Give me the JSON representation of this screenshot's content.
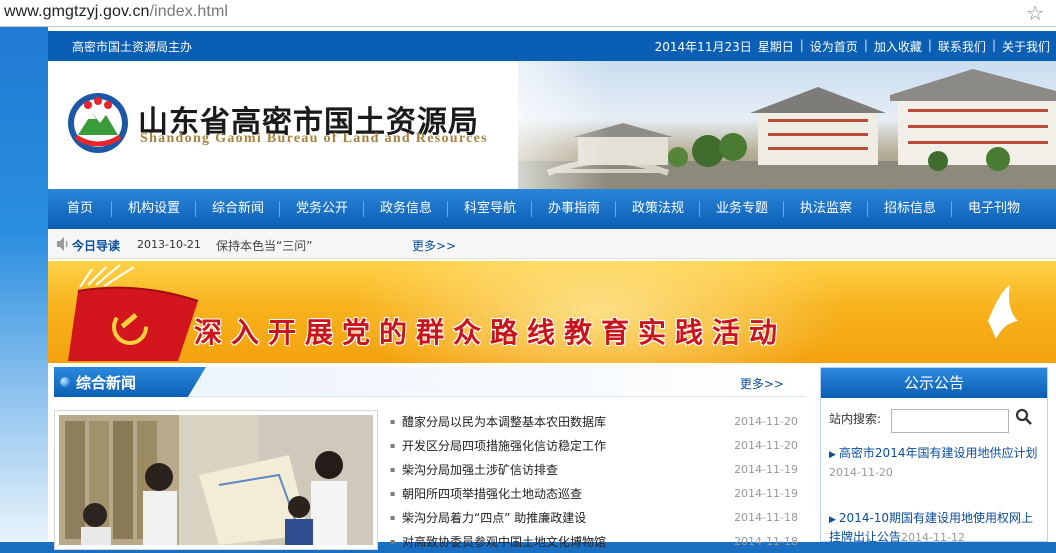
{
  "browser": {
    "url_host": "www.gmgtzyj.gov.cn",
    "url_path": "/index.html",
    "star_icon": "☆"
  },
  "topbar": {
    "sponsor": "高密市国土资源局主办",
    "date": "2014年11月23日",
    "weekday": "星期日",
    "links": [
      "设为首页",
      "加入收藏",
      "联系我们",
      "关于我们"
    ]
  },
  "header": {
    "title_cn": "山东省高密市国土资源局",
    "title_en": "Shandong Gaomi Bureau of Land and Resources"
  },
  "nav": {
    "items": [
      "首页",
      "机构设置",
      "综合新闻",
      "党务公开",
      "政务信息",
      "科室导航",
      "办事指南",
      "政策法规",
      "业务专题",
      "执法监察",
      "招标信息",
      "电子刊物"
    ]
  },
  "guide": {
    "label": "今日导读",
    "date": "2013-10-21",
    "text": "保持本色当“三问”",
    "more": "更多>>"
  },
  "banner": {
    "slogan": "深入开展党的群众路线教育实践活动",
    "accent": "#c8141c"
  },
  "news": {
    "title": "综合新闻",
    "more": "更多>>",
    "items": [
      {
        "title": "醴家分局以民为本调整基本农田数据库",
        "date": "2014-11-20"
      },
      {
        "title": "开发区分局四项措施强化信访稳定工作",
        "date": "2014-11-20"
      },
      {
        "title": "柴沟分局加强土涉矿信访排查",
        "date": "2014-11-19"
      },
      {
        "title": "朝阳所四项举措强化土地动态巡查",
        "date": "2014-11-19"
      },
      {
        "title": "柴沟分局着力“四点” 助推廉政建设",
        "date": "2014-11-18"
      },
      {
        "title": "对高致协委员参观中国土地文化博物馆",
        "date": "2014-11-18"
      }
    ]
  },
  "notice": {
    "title": "公示公告",
    "search_label": "站内搜索:",
    "search_value": "",
    "items": [
      {
        "title": "高密市2014年国有建设用地供应计划",
        "date": "2014-11-20"
      },
      {
        "title": "2014-10期国有建设用地使用权网上挂牌出让公告",
        "date": "2014-11-12"
      }
    ]
  }
}
